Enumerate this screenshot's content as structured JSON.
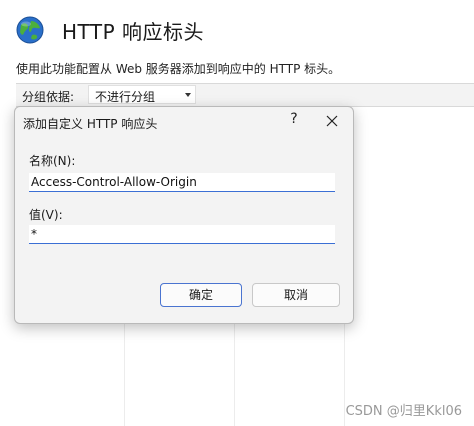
{
  "page": {
    "title": "HTTP 响应标头",
    "description": "使用此功能配置从 Web 服务器添加到响应中的 HTTP 标头。",
    "icon": "globe-icon"
  },
  "toolbar": {
    "group_label": "分组依据:",
    "group_value": "不进行分组"
  },
  "dialog": {
    "title": "添加自定义 HTTP 响应头",
    "help_label": "?",
    "name_label": "名称(N):",
    "name_value": "Access-Control-Allow-Origin",
    "value_label": "值(V):",
    "value_value": "*",
    "ok_label": "确定",
    "cancel_label": "取消"
  },
  "watermark": "CSDN @归里Kkl06",
  "colors": {
    "accent": "#3b6fd4",
    "dialog_bg": "#f3f3f3",
    "toolbar_bg": "#f3f3f3"
  }
}
